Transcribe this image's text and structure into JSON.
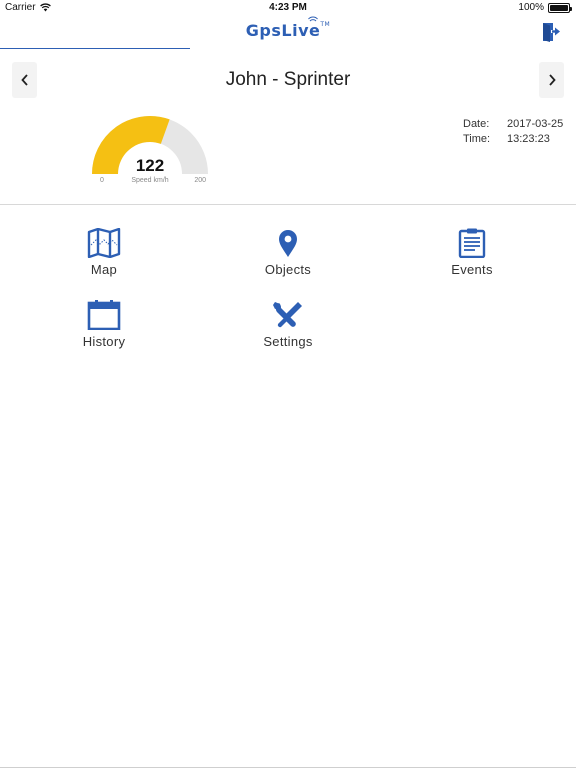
{
  "status_bar": {
    "carrier": "Carrier",
    "time": "4:23 PM",
    "battery": "100%",
    "battery_level": 1.0
  },
  "nav": {
    "logo_text": "GpsLive",
    "logo_tm": "TM",
    "progress": 0.33
  },
  "vehicle": {
    "name": "John - Sprinter"
  },
  "gauge": {
    "value": "122",
    "min": "0",
    "max": "200",
    "label": "Speed km/h",
    "fill_fraction": 0.61,
    "fill_color": "#f5c013",
    "track_color": "#e6e6e6"
  },
  "info": {
    "date_label": "Date:",
    "date_value": "2017-03-25",
    "time_label": "Time:",
    "time_value": "13:23:23"
  },
  "menu": {
    "map": "Map",
    "objects": "Objects",
    "events": "Events",
    "history": "History",
    "settings": "Settings"
  },
  "colors": {
    "accent": "#2d5fb4"
  },
  "icons": {
    "map": "map-icon",
    "objects": "location-pin-icon",
    "events": "clipboard-icon",
    "history": "calendar-icon",
    "settings": "tools-icon",
    "logout": "logout-door-icon"
  }
}
